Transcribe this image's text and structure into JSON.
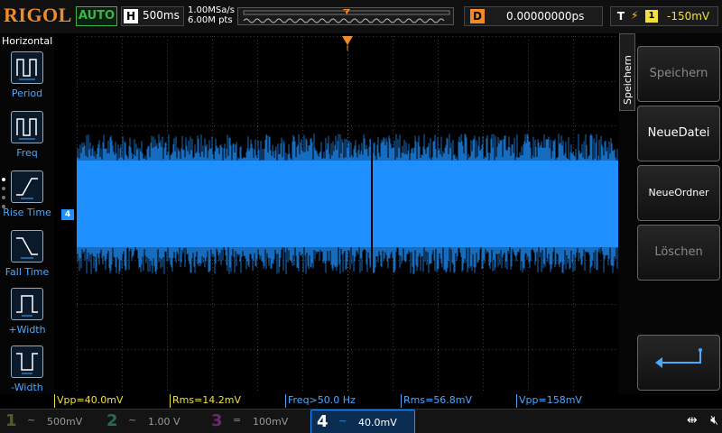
{
  "top": {
    "logo": "RIGOL",
    "run_mode": "AUTO",
    "timebase_label": "H",
    "timebase_value": "500ms",
    "sample_rate": "1.00MSa/s",
    "memory_depth": "6.00M pts",
    "trigger_marker": "T",
    "delay_label": "D",
    "delay_value": "0.00000000ps",
    "trigger_label": "T",
    "trigger_source": "1",
    "trigger_level": "-150mV"
  },
  "left_menu": {
    "title": "Horizontal",
    "items": [
      {
        "label": "Period",
        "icon": "period-icon"
      },
      {
        "label": "Freq",
        "icon": "freq-icon"
      },
      {
        "label": "Rise Time",
        "icon": "rise-time-icon"
      },
      {
        "label": "Fall Time",
        "icon": "fall-time-icon"
      },
      {
        "label": "+Width",
        "icon": "positive-width-icon"
      },
      {
        "label": "-Width",
        "icon": "negative-width-icon"
      }
    ]
  },
  "right_menu": {
    "tab_label": "Speichern",
    "keys": [
      {
        "label": "Speichern",
        "state": "disabled"
      },
      {
        "label": "NeueDatei",
        "state": "enabled"
      },
      {
        "label": "NeueOrdner",
        "state": "enabled"
      },
      {
        "label": "Löschen",
        "state": "disabled"
      },
      {
        "label": "",
        "state": "enabled",
        "icon": "return-arrow-icon"
      }
    ]
  },
  "measurements": [
    {
      "text": "Vpp=40.0mV",
      "color": "#f0e040"
    },
    {
      "text": "Rms=14.2mV",
      "color": "#f0e040"
    },
    {
      "text": "Freq>50.0 Hz",
      "color": "#4aa8ff"
    },
    {
      "text": "Rms=56.8mV",
      "color": "#4aa8ff"
    },
    {
      "text": "Vpp=158mV",
      "color": "#4aa8ff"
    }
  ],
  "channels": [
    {
      "num": "1",
      "coupling": "~",
      "scale": "500mV",
      "color": "#f0e040",
      "active": false
    },
    {
      "num": "2",
      "coupling": "~",
      "scale": "1.00 V",
      "color": "#3fcf9a",
      "active": false
    },
    {
      "num": "3",
      "coupling": "=",
      "scale": "100mV",
      "color": "#d040d0",
      "active": false
    },
    {
      "num": "4",
      "coupling": "~",
      "scale": "40.0mV",
      "color": "#1e90ff",
      "active": true
    }
  ],
  "ch4_marker": "4",
  "colors": {
    "waveform": "#1e90ff",
    "grid": "#3a3a3a",
    "trigger": "#f08a2a",
    "accent": "#1e90ff"
  }
}
